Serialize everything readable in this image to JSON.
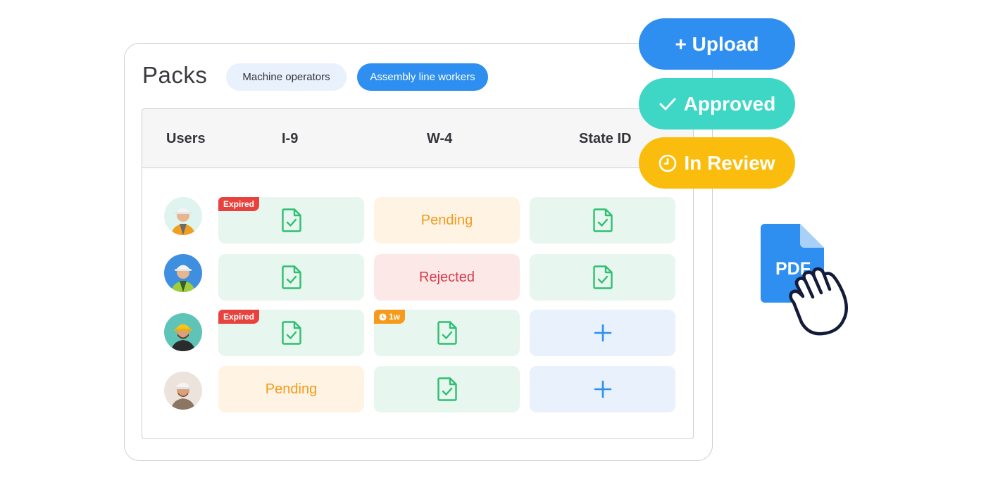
{
  "packs": {
    "title": "Packs",
    "chips": [
      {
        "label": "Machine operators",
        "selected": false
      },
      {
        "label": "Assembly line workers",
        "selected": true
      }
    ]
  },
  "table": {
    "headers": [
      "Users",
      "I-9",
      "W-4",
      "State ID"
    ],
    "rows": [
      {
        "user": "worker-1",
        "i9": {
          "status": "document-approved",
          "tag": "Expired"
        },
        "w4": {
          "status": "text",
          "text": "Pending"
        },
        "state_id": {
          "status": "document-approved"
        }
      },
      {
        "user": "worker-2",
        "i9": {
          "status": "document-approved"
        },
        "w4": {
          "status": "text",
          "text": "Rejected"
        },
        "state_id": {
          "status": "document-approved"
        }
      },
      {
        "user": "worker-3",
        "i9": {
          "status": "document-approved",
          "tag": "Expired"
        },
        "w4": {
          "status": "document-approved",
          "tag": "1w"
        },
        "state_id": {
          "status": "add"
        }
      },
      {
        "user": "worker-4",
        "i9": {
          "status": "text",
          "text": "Pending"
        },
        "w4": {
          "status": "document-approved"
        },
        "state_id": {
          "status": "add"
        }
      }
    ]
  },
  "actions": {
    "upload": "+ Upload",
    "approved": "Approved",
    "in_review": "In Review"
  },
  "file": {
    "label": "PDF"
  },
  "colors": {
    "primary": "#2e8ff0",
    "approved": "#3ed7c6",
    "in_review": "#fbbd0d",
    "expired": "#e8423f",
    "pending": "#f59a1b",
    "rejected": "#d83b49",
    "doc_green": "#2fbf71"
  }
}
